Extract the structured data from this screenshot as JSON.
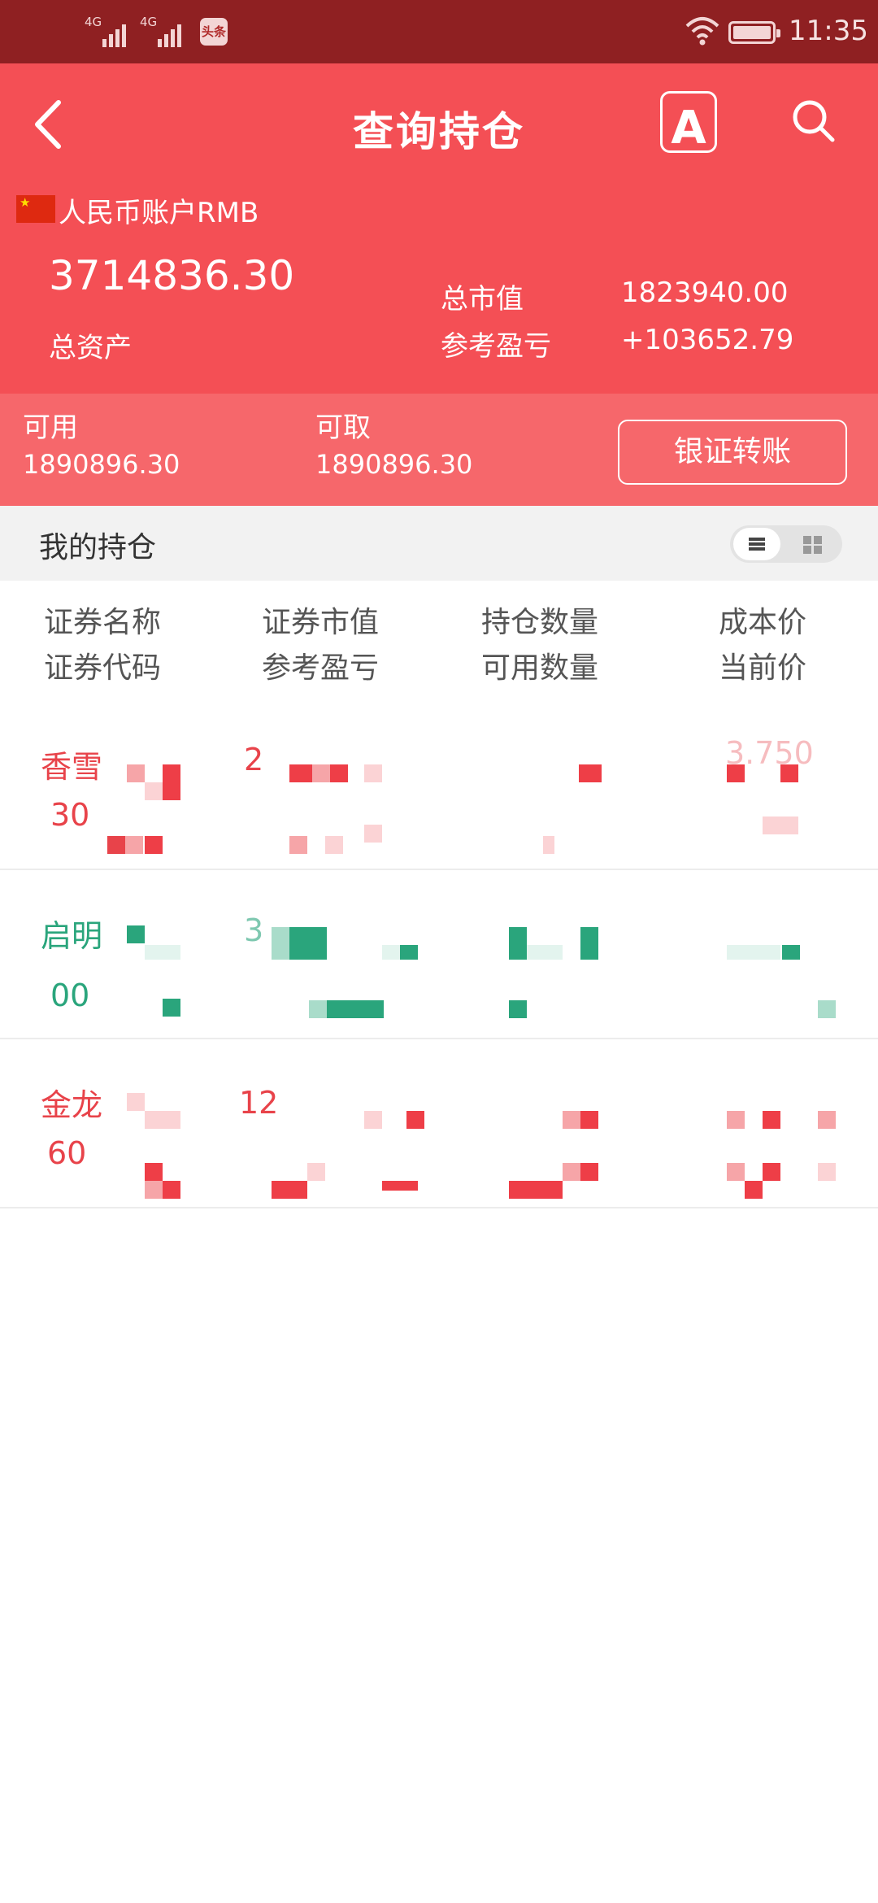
{
  "status_bar": {
    "signal1_label": "4G",
    "signal2_label": "4G",
    "news_badge": "头条",
    "time": "11:35"
  },
  "header": {
    "title": "查询持仓",
    "font_button": "A"
  },
  "account": {
    "label": "人民币账户RMB",
    "total_assets_value": "3714836.30",
    "total_assets_label": "总资产",
    "market_value_label": "总市值",
    "market_value": "1823940.00",
    "pnl_label": "参考盈亏",
    "pnl_value": "+103652.79"
  },
  "funds": {
    "available_label": "可用",
    "available_value": "1890896.30",
    "withdrawable_label": "可取",
    "withdrawable_value": "1890896.30",
    "transfer_button": "银证转账"
  },
  "holdings": {
    "title": "我的持仓",
    "columns": [
      {
        "line1": "证券名称",
        "line2": "证券代码"
      },
      {
        "line1": "证券市值",
        "line2": "参考盈亏"
      },
      {
        "line1": "持仓数量",
        "line2": "可用数量"
      },
      {
        "line1": "成本价",
        "line2": "当前价"
      }
    ],
    "rows": [
      {
        "name": "香雪",
        "code": "30",
        "market_value_partial": "2",
        "cost_partial": "3.750",
        "trend": "up"
      },
      {
        "name": "启明",
        "code": "00",
        "market_value_partial": "3",
        "cost_partial": "",
        "trend": "down"
      },
      {
        "name": "金龙",
        "code": "60",
        "market_value_partial": "12",
        "cost_partial": "",
        "trend": "up"
      }
    ]
  },
  "colors": {
    "status_bar": "#8f2022",
    "header": "#f44f55",
    "funds_panel": "#f6676b",
    "up": "#e8434a",
    "down": "#2aa57c"
  }
}
